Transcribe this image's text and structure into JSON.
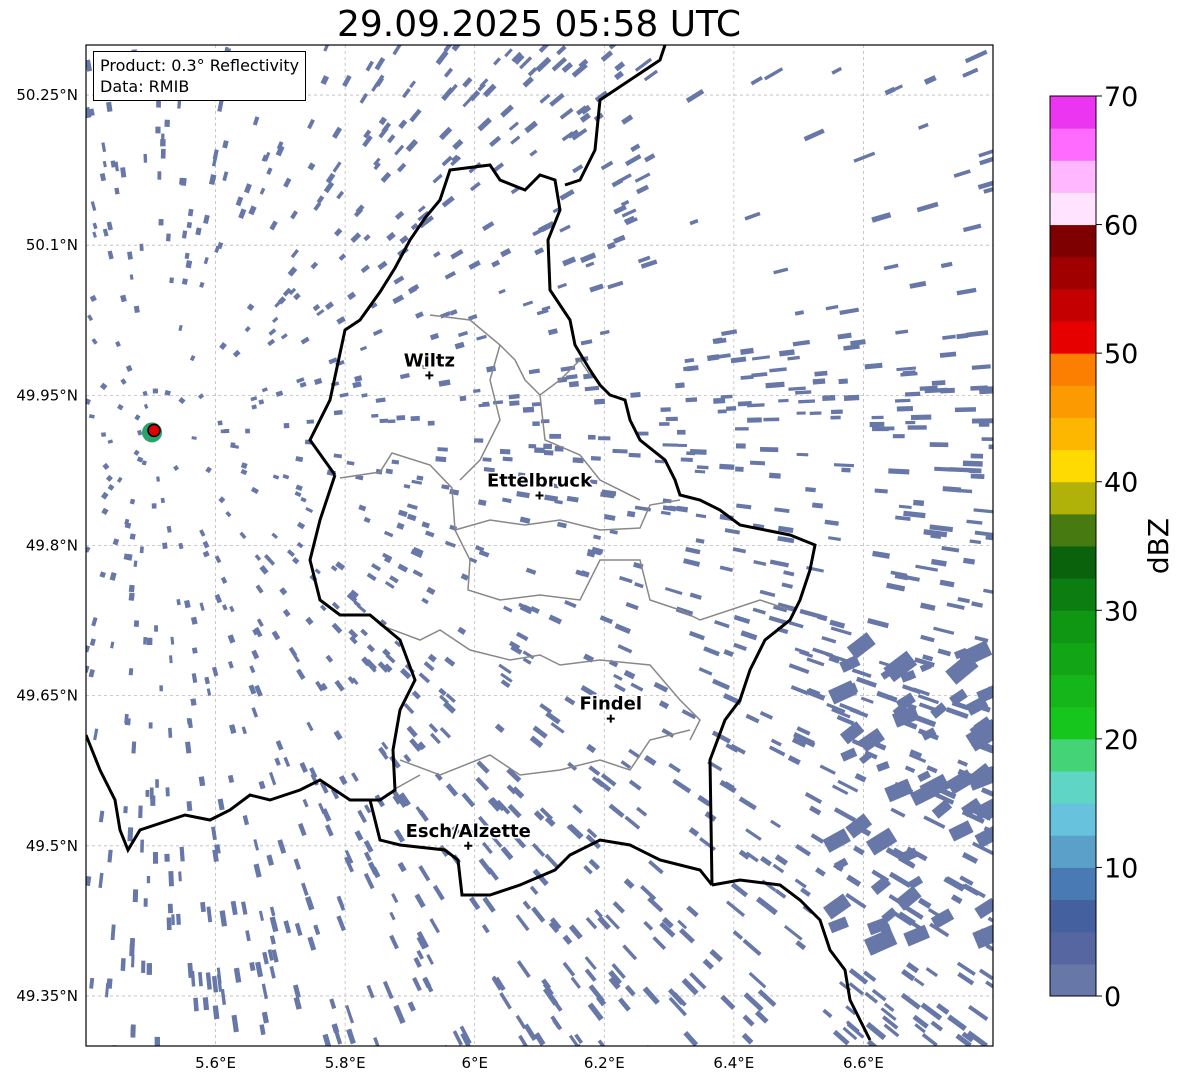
{
  "title": "29.09.2025 05:58 UTC",
  "info": {
    "product": "Product: 0.3° Reflectivity",
    "source": "Data: RMIB"
  },
  "map": {
    "lon_range": [
      5.4,
      6.8
    ],
    "lat_range": [
      49.3,
      50.3
    ],
    "lon_ticks": [
      {
        "value": 5.6,
        "label": "5.6°E"
      },
      {
        "value": 5.8,
        "label": "5.8°E"
      },
      {
        "value": 6.0,
        "label": "6°E"
      },
      {
        "value": 6.2,
        "label": "6.2°E"
      },
      {
        "value": 6.4,
        "label": "6.4°E"
      },
      {
        "value": 6.6,
        "label": "6.6°E"
      }
    ],
    "lat_ticks": [
      {
        "value": 49.35,
        "label": "49.35°N"
      },
      {
        "value": 49.5,
        "label": "49.5°N"
      },
      {
        "value": 49.65,
        "label": "49.65°N"
      },
      {
        "value": 49.8,
        "label": "49.8°N"
      },
      {
        "value": 49.95,
        "label": "49.95°N"
      },
      {
        "value": 50.1,
        "label": "50.1°N"
      },
      {
        "value": 50.25,
        "label": "50.25°N"
      }
    ],
    "cities": [
      {
        "name": "Wiltz",
        "lon": 5.93,
        "lat": 49.97
      },
      {
        "name": "Ettelbruck",
        "lon": 6.1,
        "lat": 49.85
      },
      {
        "name": "Findel",
        "lon": 6.21,
        "lat": 49.627
      },
      {
        "name": "Esch/Alzette",
        "lon": 5.99,
        "lat": 49.5
      }
    ],
    "radar_site": {
      "lon": 5.505,
      "lat": 49.915,
      "color": "#e00000"
    },
    "echo_color": "#6677a8"
  },
  "colorbar": {
    "label": "dBZ",
    "min": 0,
    "max": 70,
    "step": 2.5,
    "ticks": [
      "0",
      "10",
      "20",
      "30",
      "40",
      "50",
      "60",
      "70"
    ],
    "colors": [
      "#6677a8",
      "#5566a0",
      "#44609e",
      "#4a7ab3",
      "#5aa0c8",
      "#66c2dd",
      "#5fd6c5",
      "#44d477",
      "#16c61c",
      "#14b61a",
      "#12a616",
      "#0f9613",
      "#0c7d10",
      "#0a620d",
      "#477b11",
      "#b0b209",
      "#fed902",
      "#fdb701",
      "#fc9b01",
      "#fd7f01",
      "#e60000",
      "#c40000",
      "#a00000",
      "#7e0000",
      "#ffe3ff",
      "#ffb7ff",
      "#ff6bff",
      "#eb35f0"
    ]
  }
}
